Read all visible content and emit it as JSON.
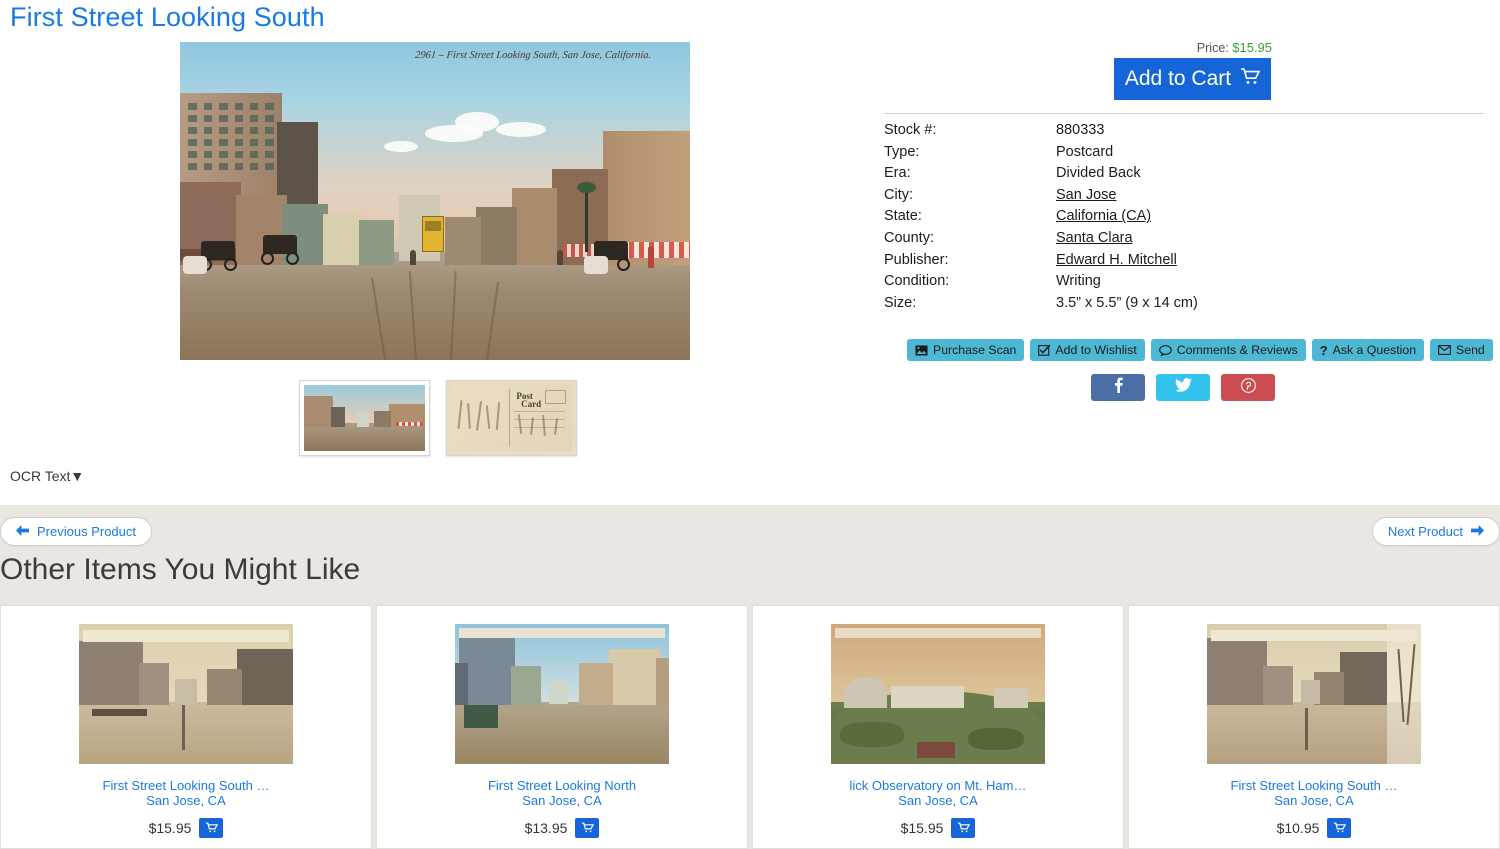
{
  "product": {
    "title": "First Street Looking South",
    "postcard_caption": "2961  –  First Street Looking South, San Jose, California.",
    "ocr_toggle_label": "OCR Text▼"
  },
  "purchase": {
    "price_label": "Price:",
    "price": "$15.95",
    "add_to_cart_label": "Add to Cart",
    "cart_icon": "shopping-cart-icon"
  },
  "details": [
    {
      "label": "Stock #:",
      "value": "880333",
      "link": false
    },
    {
      "label": "Type:",
      "value": "Postcard",
      "link": false
    },
    {
      "label": "Era:",
      "value": "Divided Back",
      "link": false
    },
    {
      "label": "City:",
      "value": "San Jose",
      "link": true
    },
    {
      "label": "State:",
      "value": "California (CA)",
      "link": true
    },
    {
      "label": "County:",
      "value": "Santa Clara",
      "link": true
    },
    {
      "label": "Publisher:",
      "value": "Edward H. Mitchell",
      "link": true
    },
    {
      "label": "Condition:",
      "value": "Writing",
      "link": false
    },
    {
      "label": "Size:",
      "value": "3.5” x 5.5” (9 x 14 cm)",
      "link": false
    }
  ],
  "actions": [
    {
      "label": "Purchase Scan",
      "icon": "image-icon"
    },
    {
      "label": "Add to Wishlist",
      "icon": "check-square-icon"
    },
    {
      "label": "Comments & Reviews",
      "icon": "speech-bubble-icon"
    },
    {
      "label": "Ask a Question",
      "icon": "question-mark-icon"
    },
    {
      "label": "Send",
      "icon": "envelope-icon"
    }
  ],
  "social": [
    {
      "name": "facebook",
      "icon": "facebook-icon",
      "color": "#4c6ea7"
    },
    {
      "name": "twitter",
      "icon": "twitter-icon",
      "color": "#32c3ec"
    },
    {
      "name": "pinterest",
      "icon": "pinterest-icon",
      "color": "#cb4d52"
    }
  ],
  "thumbnails": [
    {
      "name": "front-view",
      "alt": "Postcard front: First Street looking south"
    },
    {
      "name": "back-view",
      "alt": "Postcard back with handwriting",
      "post_word": "Post",
      "card_word": "Card"
    }
  ],
  "navigation": {
    "previous_label": "Previous Product",
    "next_label": "Next Product",
    "prev_icon": "arrow-left-icon",
    "next_icon": "arrow-right-icon"
  },
  "related": {
    "heading": "Other Items You Might Like",
    "items": [
      {
        "title": "First Street Looking South …",
        "location": "San Jose, CA",
        "price": "$15.95",
        "theme": "street-sepia"
      },
      {
        "title": "First Street Looking North",
        "location": "San Jose, CA",
        "price": "$13.95",
        "theme": "street-color"
      },
      {
        "title": "lick Observatory on Mt. Ham…",
        "location": "San Jose, CA",
        "price": "$15.95",
        "theme": "observatory"
      },
      {
        "title": "First Street Looking South …",
        "location": "San Jose, CA",
        "price": "$10.95",
        "theme": "street-writing"
      }
    ]
  },
  "colors": {
    "link_blue": "#1a7ae4",
    "button_blue": "#1565d8",
    "action_teal": "#4db8d4",
    "price_green": "#3a9e3a",
    "page_bg": "#eae6e2"
  }
}
